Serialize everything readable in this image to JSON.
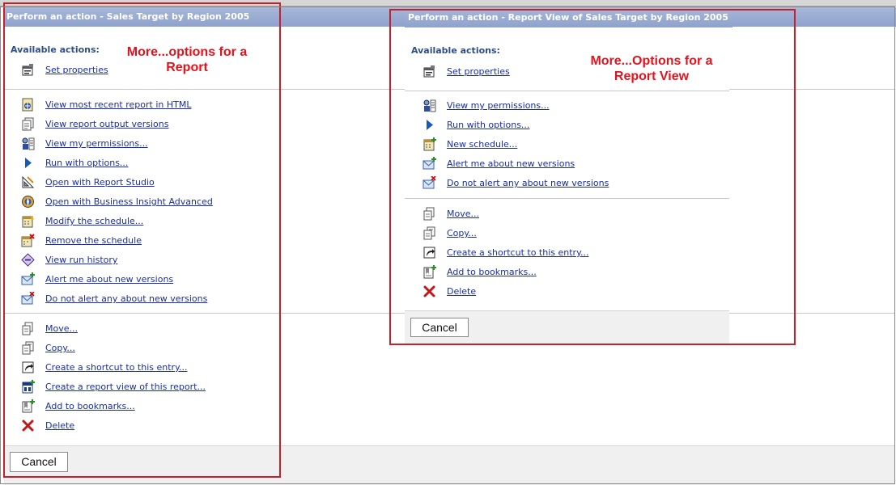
{
  "left_panel": {
    "title": "Perform an action - Sales Target by Region 2005",
    "available_label": "Available actions:",
    "annotation_line1": "More...options for a",
    "annotation_line2": "Report",
    "groups": [
      [
        {
          "icon": "properties-icon",
          "label": "Set properties"
        }
      ],
      [
        {
          "icon": "html-report-icon",
          "label": "View most recent report in HTML"
        },
        {
          "icon": "output-versions-icon",
          "label": "View report output versions"
        },
        {
          "icon": "permissions-icon",
          "label": "View my permissions..."
        },
        {
          "icon": "run-icon",
          "label": "Run with options..."
        },
        {
          "icon": "report-studio-icon",
          "label": "Open with Report Studio"
        },
        {
          "icon": "business-insight-icon",
          "label": "Open with Business Insight Advanced"
        },
        {
          "icon": "schedule-icon",
          "label": "Modify the schedule..."
        },
        {
          "icon": "remove-schedule-icon",
          "label": "Remove the schedule"
        },
        {
          "icon": "run-history-icon",
          "label": "View run history"
        },
        {
          "icon": "alert-icon",
          "label": "Alert me about new versions"
        },
        {
          "icon": "no-alert-icon",
          "label": "Do not alert any about new versions"
        }
      ],
      [
        {
          "icon": "move-icon",
          "label": "Move..."
        },
        {
          "icon": "copy-icon",
          "label": "Copy..."
        },
        {
          "icon": "shortcut-icon",
          "label": "Create a shortcut to this entry..."
        },
        {
          "icon": "report-view-icon",
          "label": "Create a report view of this report..."
        },
        {
          "icon": "bookmark-icon",
          "label": "Add to bookmarks..."
        },
        {
          "icon": "delete-icon",
          "label": "Delete"
        }
      ]
    ],
    "cancel_label": "Cancel"
  },
  "right_panel": {
    "title": "Perform an action - Report View of Sales Target by Region 2005",
    "available_label": "Available actions:",
    "annotation_line1": "More...Options for a",
    "annotation_line2": "Report View",
    "groups": [
      [
        {
          "icon": "properties-icon",
          "label": "Set properties"
        }
      ],
      [
        {
          "icon": "permissions-icon",
          "label": "View my permissions..."
        },
        {
          "icon": "run-icon",
          "label": "Run with options..."
        },
        {
          "icon": "new-schedule-icon",
          "label": "New schedule..."
        },
        {
          "icon": "alert-icon",
          "label": "Alert me about new versions"
        },
        {
          "icon": "no-alert-icon",
          "label": "Do not alert any about new versions"
        }
      ],
      [
        {
          "icon": "move-icon",
          "label": "Move..."
        },
        {
          "icon": "copy-icon",
          "label": "Copy..."
        },
        {
          "icon": "shortcut-icon",
          "label": "Create a shortcut to this entry..."
        },
        {
          "icon": "bookmark-icon",
          "label": "Add to bookmarks..."
        },
        {
          "icon": "delete-icon",
          "label": "Delete"
        }
      ]
    ],
    "cancel_label": "Cancel"
  },
  "colors": {
    "link": "#1a2ea6",
    "annotation": "#e0141e",
    "header": "#8ea2cc",
    "border": "#c8202a"
  }
}
